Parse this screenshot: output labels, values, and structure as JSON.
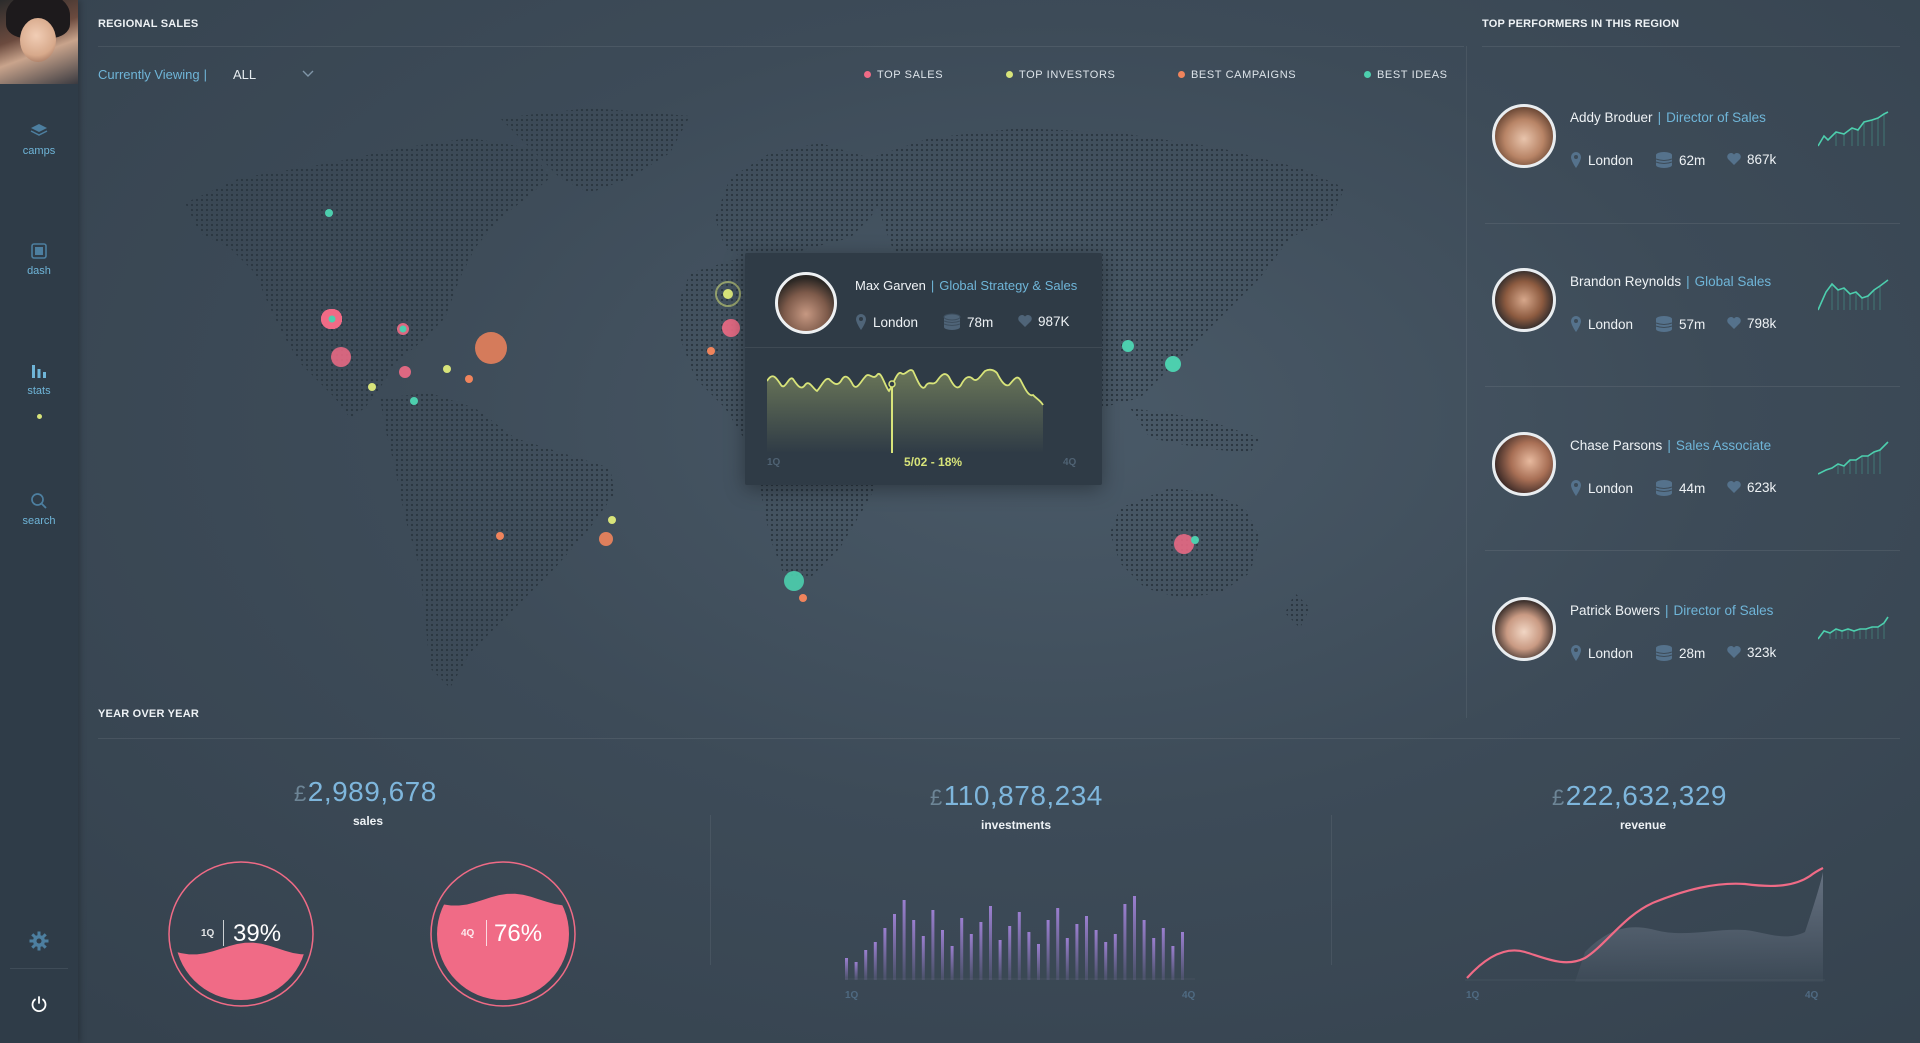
{
  "sidebar": {
    "items": [
      {
        "label": "camps"
      },
      {
        "label": "dash"
      },
      {
        "label": "stats"
      },
      {
        "label": "search"
      }
    ]
  },
  "regional": {
    "title": "REGIONAL SALES",
    "viewing_label": "Currently Viewing",
    "viewing_sep": "|",
    "viewing_value": "ALL",
    "legend": [
      {
        "label": "TOP SALES",
        "color": "#f06b86"
      },
      {
        "label": "TOP INVESTORS",
        "color": "#d8e47a"
      },
      {
        "label": "BEST CAMPAIGNS",
        "color": "#f0845c"
      },
      {
        "label": "BEST IDEAS",
        "color": "#4dcfae"
      }
    ]
  },
  "popup": {
    "name": "Max Garven",
    "sep": "|",
    "role": "Global Strategy & Sales",
    "location": "London",
    "coins": "78m",
    "likes": "987K",
    "axis_start": "1Q",
    "axis_end": "4Q",
    "marker_label": "5/02 - 18%"
  },
  "performers": {
    "title": "TOP PERFORMERS IN THIS REGION",
    "items": [
      {
        "name": "Addy Broduer",
        "role": "Director of Sales",
        "location": "London",
        "coins": "62m",
        "likes": "867k"
      },
      {
        "name": "Brandon Reynolds",
        "role": "Global Sales",
        "location": "London",
        "coins": "57m",
        "likes": "798k"
      },
      {
        "name": "Chase Parsons",
        "role": "Sales Associate",
        "location": "London",
        "coins": "44m",
        "likes": "623k"
      },
      {
        "name": "Patrick Bowers",
        "role": "Director of Sales",
        "location": "London",
        "coins": "28m",
        "likes": "323k"
      }
    ]
  },
  "yoy": {
    "title": "YEAR OVER YEAR",
    "currency": "£",
    "sales": {
      "value": "2,989,678",
      "label": "sales"
    },
    "investments": {
      "value": "110,878,234",
      "label": "investments"
    },
    "revenue": {
      "value": "222,632,329",
      "label": "revenue"
    },
    "gauge1": {
      "q": "1Q",
      "pct": "39%",
      "fill": 0.39
    },
    "gauge2": {
      "q": "4Q",
      "pct": "76%",
      "fill": 0.76
    },
    "axis_start": "1Q",
    "axis_end": "4Q"
  },
  "colors": {
    "accent_blue": "#6fb5d8",
    "pink": "#f06b86",
    "yellow": "#d8e47a",
    "orange": "#f0845c",
    "teal": "#4dcfae",
    "purple": "#9b7fd0"
  }
}
